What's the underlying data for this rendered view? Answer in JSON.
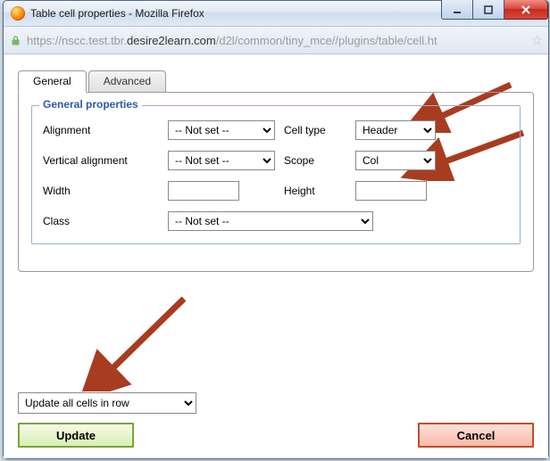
{
  "window": {
    "title": "Table cell properties - Mozilla Firefox"
  },
  "url": {
    "scheme": "https://",
    "pre_host": "nscc.test.tbr.",
    "host": "desire2learn.com",
    "path": "/d2l/common/tiny_mce//plugins/table/cell.ht"
  },
  "tabs": {
    "general": "General",
    "advanced": "Advanced"
  },
  "fieldset": {
    "legend": "General properties",
    "labels": {
      "alignment": "Alignment",
      "valign": "Vertical alignment",
      "width": "Width",
      "class": "Class",
      "celltype": "Cell type",
      "scope": "Scope",
      "height": "Height"
    },
    "values": {
      "alignment": "-- Not set --",
      "valign": "-- Not set --",
      "width": "",
      "class": "-- Not set --",
      "celltype": "Header",
      "scope": "Col",
      "height": ""
    }
  },
  "footer": {
    "scope_select": "Update all cells in row",
    "update": "Update",
    "cancel": "Cancel"
  }
}
